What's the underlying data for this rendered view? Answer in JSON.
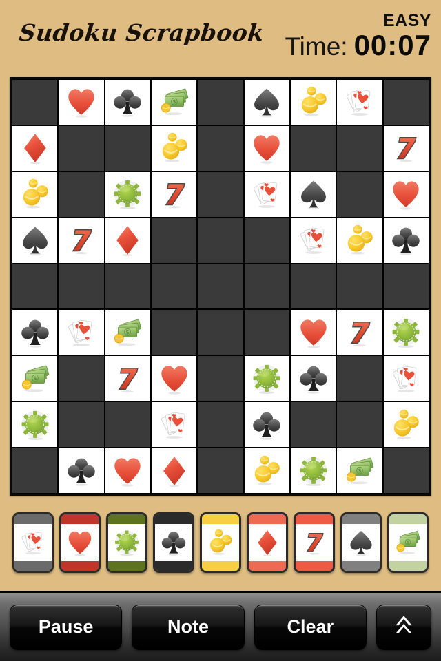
{
  "header": {
    "title": "Sudoku Scrapbook",
    "difficulty": "EASY",
    "timer_label": "Time:",
    "timer_value": "00:07"
  },
  "board": {
    "size": 9,
    "symbol_names": [
      "cards",
      "heart",
      "chip",
      "club",
      "coins",
      "diamond",
      "seven",
      "spade",
      "money"
    ],
    "empty_cell_color": "#3a3a3a",
    "filled_cell_color": "#ffffff",
    "grid_line_color": "#000000",
    "rows": [
      [
        "",
        "heart",
        "club",
        "money",
        "",
        "spade",
        "coins",
        "cards",
        ""
      ],
      [
        "diamond",
        "",
        "",
        "coins",
        "",
        "heart",
        "",
        "",
        "seven"
      ],
      [
        "coins",
        "",
        "chip",
        "seven",
        "",
        "cards",
        "spade",
        "",
        "heart"
      ],
      [
        "spade",
        "seven",
        "diamond",
        "",
        "",
        "",
        "cards",
        "coins",
        "club"
      ],
      [
        "",
        "",
        "",
        "",
        "",
        "",
        "",
        "",
        ""
      ],
      [
        "club",
        "cards",
        "money",
        "",
        "",
        "",
        "heart",
        "seven",
        "chip"
      ],
      [
        "money",
        "",
        "seven",
        "heart",
        "",
        "chip",
        "club",
        "",
        "cards"
      ],
      [
        "chip",
        "",
        "",
        "cards",
        "",
        "club",
        "",
        "",
        "coins"
      ],
      [
        "",
        "club",
        "heart",
        "diamond",
        "",
        "coins",
        "chip",
        "money",
        ""
      ]
    ]
  },
  "palette": {
    "tiles": [
      {
        "symbol": "cards",
        "label": "Cards",
        "color": "#6b6b6b"
      },
      {
        "symbol": "heart",
        "label": "Heart",
        "color": "#c0342a"
      },
      {
        "symbol": "chip",
        "label": "Chip",
        "color": "#5d7320"
      },
      {
        "symbol": "club",
        "label": "Club",
        "color": "#2b2b2b"
      },
      {
        "symbol": "coins",
        "label": "Coins",
        "color": "#f6cf42"
      },
      {
        "symbol": "diamond",
        "label": "Diamond",
        "color": "#ef6a52"
      },
      {
        "symbol": "seven",
        "label": "Seven",
        "color": "#ef5a44"
      },
      {
        "symbol": "spade",
        "label": "Spade",
        "color": "#808080"
      },
      {
        "symbol": "money",
        "label": "Money",
        "color": "#c2d2a0"
      }
    ]
  },
  "toolbar": {
    "pause_label": "Pause",
    "note_label": "Note",
    "clear_label": "Clear",
    "scroll_icon": "double-chevron-up"
  },
  "theme": {
    "background": "#dfbd82",
    "bar_dark": "#1c1c1c",
    "accent_red": "#e8503a",
    "accent_green": "#8cb63c",
    "accent_yellow": "#f5c62e"
  }
}
